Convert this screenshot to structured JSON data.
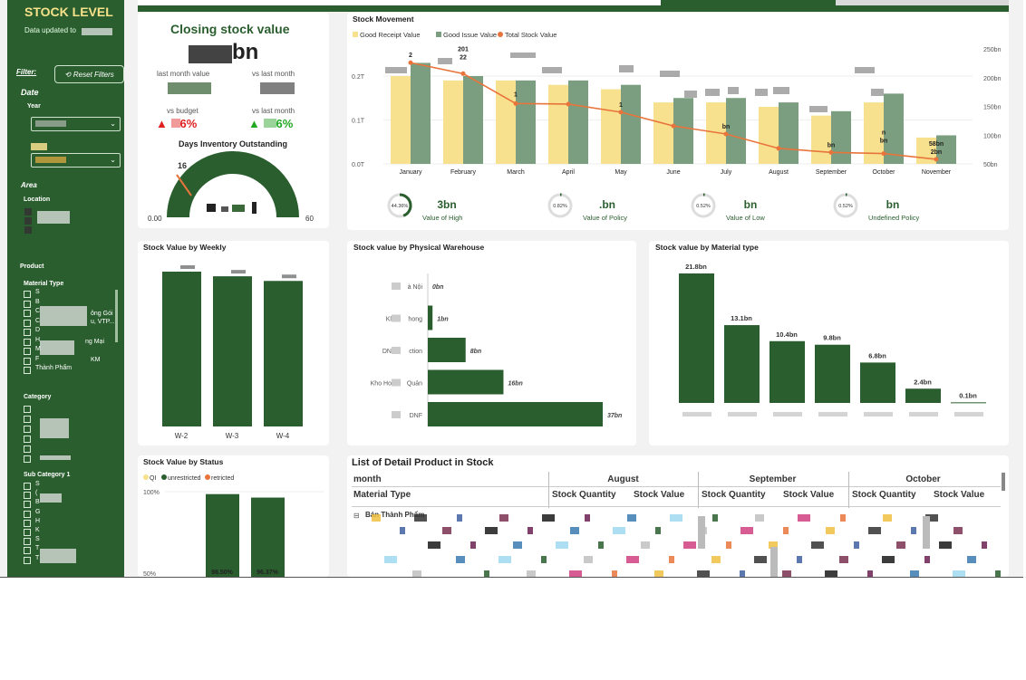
{
  "sidebar": {
    "title": "STOCK LEVEL",
    "updated": "Data updated to",
    "filter_label": "Filter:",
    "reset_label": "Reset Filters",
    "date_label": "Date",
    "year_label": "Year",
    "area_label": "Area",
    "location_label": "Location",
    "product_label": "Product",
    "material_type_label": "Material Type",
    "material_items": [
      "S",
      "B",
      "C",
      "C",
      "D",
      "H",
      "M",
      "F",
      "Thành Phẩm"
    ],
    "material_partial": [
      "ông Gói",
      "u, VTP...",
      "ng Mại",
      "KM"
    ],
    "category_label": "Category",
    "subcat_label": "Sub Category 1",
    "subcat_items": [
      "S",
      "(",
      "B",
      "G",
      "H",
      "K",
      "S",
      "T",
      "T"
    ]
  },
  "kpi": {
    "title": "Closing stock value",
    "value": "bn",
    "last_month_value": "last month value",
    "vs_last_month_1": "vs last month",
    "vs_budget": "vs budget",
    "vs_last_month_2": "vs last month",
    "budget_delta": "6%",
    "last_month_delta": "6%",
    "dio_title": "Days Inventory Outstanding",
    "gauge_min": "0.00",
    "gauge_max": "60",
    "gauge_marker": "16"
  },
  "stock_movement": {
    "title": "Stock Movement",
    "legend": [
      {
        "name": "Good Receipt Value",
        "color": "#f7e08e"
      },
      {
        "name": "Good Issue Value",
        "color": "#7a9e7f"
      },
      {
        "name": "Total Stock Value",
        "color": "#e8743b"
      }
    ],
    "left_ticks": [
      "0.2T",
      "0.1T",
      "0.0T"
    ],
    "right_ticks": [
      "250bn",
      "200bn",
      "150bn",
      "100bn",
      "50bn"
    ],
    "months": [
      "January",
      "February",
      "March",
      "April",
      "May",
      "June",
      "July",
      "August",
      "September",
      "October",
      "November"
    ],
    "receipt": [
      0.2,
      0.19,
      0.19,
      0.18,
      0.17,
      0.14,
      0.14,
      0.13,
      0.11,
      0.14,
      0.06
    ],
    "issue": [
      0.23,
      0.2,
      0.19,
      0.19,
      0.18,
      0.15,
      0.15,
      0.14,
      0.12,
      0.16,
      0.065
    ],
    "total": [
      226,
      207,
      155,
      154,
      140,
      116,
      102,
      77,
      70,
      68,
      58
    ],
    "labels": [
      {
        "m": 0,
        "text": "2"
      },
      {
        "m": 1,
        "text": "22"
      },
      {
        "m": 1,
        "text": "201"
      },
      {
        "m": 2,
        "text": "1"
      },
      {
        "m": 4,
        "text": "1"
      },
      {
        "m": 6,
        "text": "bn"
      },
      {
        "m": 8,
        "text": "bn"
      },
      {
        "m": 9,
        "text": "bn"
      },
      {
        "m": 9,
        "text": "n"
      },
      {
        "m": 10,
        "text": "2bn"
      },
      {
        "m": 10,
        "text": "58bn"
      }
    ],
    "summary": [
      {
        "pct": "44.36%",
        "val": "3bn",
        "lbl": "Value of High",
        "frac": 0.4436
      },
      {
        "pct": "0.82%",
        "val": ".bn",
        "lbl": "Value of Policy",
        "frac": 0.0082
      },
      {
        "pct": "0.52%",
        "val": "bn",
        "lbl": "Value of Low",
        "frac": 0.0052
      },
      {
        "pct": "0.52%",
        "val": "bn",
        "lbl": "Undefined Policy",
        "frac": 0.0052
      }
    ]
  },
  "weekly": {
    "title": "Stock Value by Weekly",
    "categories": [
      "W-2",
      "W-3",
      "W-4"
    ],
    "values": [
      1.0,
      0.97,
      0.94
    ]
  },
  "warehouse": {
    "title": "Stock value by Physical Warehouse",
    "rows": [
      {
        "label": "à Nội",
        "prefix": "",
        "value": 0,
        "text": "0bn"
      },
      {
        "label": "hong",
        "prefix": "Kl",
        "value": 1,
        "text": "1bn"
      },
      {
        "label": "ction",
        "prefix": "DN",
        "value": 8,
        "text": "8bn"
      },
      {
        "label": "Quản",
        "prefix": "Kho Ho",
        "value": 16,
        "text": "16bn"
      },
      {
        "label": "DNF",
        "prefix": "",
        "value": 37,
        "text": "37bn"
      }
    ]
  },
  "material": {
    "title": "Stock value by Material type",
    "values": [
      21.8,
      13.1,
      10.4,
      9.8,
      6.8,
      2.4,
      0.1
    ],
    "labels": [
      "21.8bn",
      "13.1bn",
      "10.4bn",
      "9.8bn",
      "6.8bn",
      "2.4bn",
      "0.1bn"
    ]
  },
  "status": {
    "title": "Stock Value by Status",
    "legend": [
      {
        "name": "QI",
        "color": "#f7e08e"
      },
      {
        "name": "unrestricted",
        "color": "#2a5e2e"
      },
      {
        "name": "retricted",
        "color": "#e8743b"
      }
    ],
    "ticks": [
      "100%",
      "50%"
    ],
    "values": [
      98.5,
      96.37
    ],
    "labels": [
      "98.50%",
      "96.37%"
    ]
  },
  "table": {
    "title": "List of Detail Product in Stock",
    "row_header": "month",
    "col_header": "Material Type",
    "months": [
      "August",
      "September",
      "October"
    ],
    "sub_cols": [
      "Stock Quantity",
      "Stock Value"
    ],
    "first_row": "Bán Thành Phẩm",
    "expander": "⊟"
  }
}
